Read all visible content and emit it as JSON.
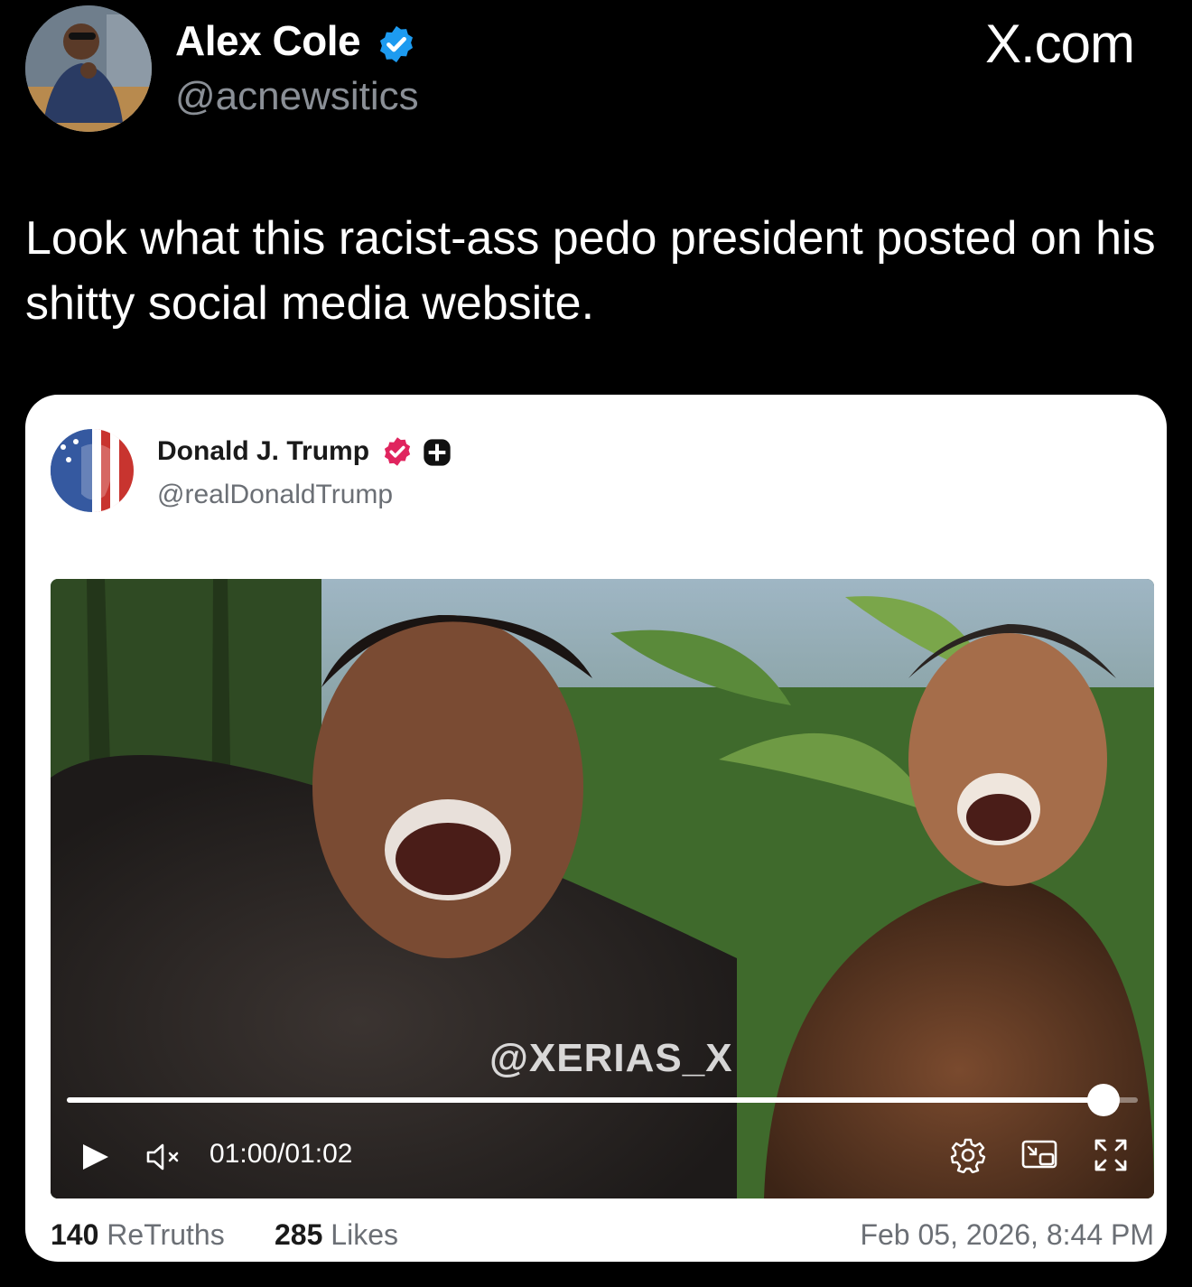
{
  "tweet": {
    "author_name": "Alex Cole",
    "handle": "@acnewsitics",
    "brand": "X.com",
    "text": "Look what this racist-ass pedo president posted on his shitty social media website.",
    "colors": {
      "background": "#000000",
      "verified": "#1d9bf0",
      "handle": "#8a8f96"
    }
  },
  "embedded_post": {
    "author_name": "Donald J. Trump",
    "handle": "@realDonaldTrump",
    "badge_color": "#e0245e",
    "video": {
      "watermark": "@XERIAS_X",
      "progress": 0.968,
      "current_time": "01:00",
      "separator": "/",
      "duration": "01:02",
      "icons": [
        "play-icon",
        "mute-icon",
        "settings-icon",
        "picture-in-picture-icon",
        "fullscreen-icon"
      ]
    },
    "retruths_count": "140",
    "retruths_label": "ReTruths",
    "likes_count": "285",
    "likes_label": "Likes",
    "date": "Feb 05, 2026, 8:44 PM"
  }
}
